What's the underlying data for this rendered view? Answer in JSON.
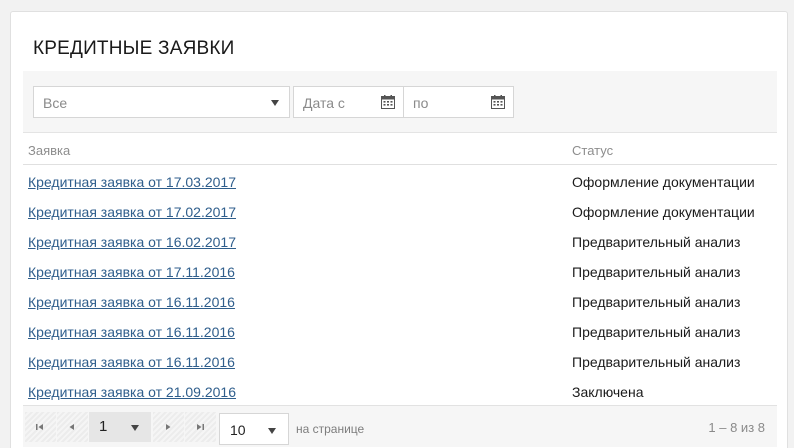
{
  "title": "КРЕДИТНЫЕ ЗАЯВКИ",
  "filters": {
    "status_select": {
      "value": "Все"
    },
    "date_from": {
      "placeholder": "Дата с"
    },
    "date_to": {
      "placeholder": "по"
    }
  },
  "table": {
    "columns": [
      "Заявка",
      "Статус"
    ],
    "rows": [
      {
        "request": "Кредитная заявка от 17.03.2017",
        "status": "Оформление документации"
      },
      {
        "request": "Кредитная заявка от 17.02.2017",
        "status": "Оформление документации"
      },
      {
        "request": "Кредитная заявка от 16.02.2017",
        "status": "Предварительный анализ"
      },
      {
        "request": "Кредитная заявка от 17.11.2016",
        "status": "Предварительный анализ"
      },
      {
        "request": "Кредитная заявка от 16.11.2016",
        "status": "Предварительный анализ"
      },
      {
        "request": "Кредитная заявка от 16.11.2016",
        "status": "Предварительный анализ"
      },
      {
        "request": "Кредитная заявка от 16.11.2016",
        "status": "Предварительный анализ"
      },
      {
        "request": "Кредитная заявка от 21.09.2016",
        "status": "Заключена"
      }
    ]
  },
  "pager": {
    "current_page": "1",
    "page_size": "10",
    "per_page_label": "на странице",
    "range_text": "1 – 8 из 8",
    "icons": [
      "first-page-icon",
      "prev-page-icon",
      "next-page-icon",
      "last-page-icon"
    ]
  },
  "colors": {
    "link": "#2f5e8c",
    "muted": "#8a8a8a",
    "panel": "#f6f6f6"
  }
}
